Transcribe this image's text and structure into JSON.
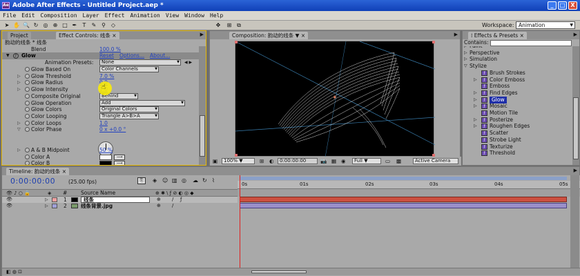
{
  "window": {
    "title": "Adobe After Effects - Untitled Project.aep *",
    "app_icon": "Ae",
    "buttons": [
      "_",
      "□",
      "X"
    ]
  },
  "menu": [
    "File",
    "Edit",
    "Composition",
    "Layer",
    "Effect",
    "Animation",
    "View",
    "Window",
    "Help"
  ],
  "toolbar": {
    "workspace_label": "Workspace:",
    "workspace_value": "Animation"
  },
  "effect_panel": {
    "tabs": [
      "Project",
      "Effect Controls: 线条"
    ],
    "header": "韵动的线条 * 线条",
    "top_row": {
      "label": "Blend",
      "value": "100.0 %"
    },
    "effect_name": "Glow",
    "effect_links": [
      "Reset",
      "Options...",
      "About..."
    ],
    "presets_label": "Animation Presets:",
    "presets_value": "None",
    "rows": [
      {
        "label": "Glow Based On",
        "type": "drop",
        "value": "Color Channels"
      },
      {
        "label": "Glow Threshold",
        "type": "val",
        "value": "7.0 %"
      },
      {
        "label": "Glow Radius",
        "type": "val",
        "value": "0.0"
      },
      {
        "label": "Glow Intensity",
        "type": "val",
        "value": "1.0"
      },
      {
        "label": "Composite Original",
        "type": "drop",
        "value": "Behind"
      },
      {
        "label": "Glow Operation",
        "type": "drop",
        "value": "Add"
      },
      {
        "label": "Glow Colors",
        "type": "drop",
        "value": "Original Colors"
      },
      {
        "label": "Color Looping",
        "type": "drop",
        "value": "Triangle A>B>A"
      },
      {
        "label": "Color Loops",
        "type": "val",
        "value": "1.0"
      },
      {
        "label": "Color Phase",
        "type": "val",
        "value": "0 x +0.0 °"
      }
    ],
    "rows_bottom": [
      {
        "label": "A & B Midpoint",
        "type": "val",
        "value": "50 %"
      },
      {
        "label": "Color A",
        "type": "swatch",
        "value": "#ffffff"
      },
      {
        "label": "Color B",
        "type": "swatch",
        "value": "#000000"
      }
    ]
  },
  "comp_panel": {
    "tab": "Composition: 韵动的线条",
    "zoom": "100%",
    "timecode": "0:00:00:00",
    "resolution": "Full",
    "camera": "Active Camera"
  },
  "presets_panel": {
    "tab": "Effects & Presets",
    "contains_label": "Contains:",
    "items": [
      {
        "label": "Paint",
        "level": 0,
        "icon": false
      },
      {
        "label": "Perspective",
        "level": 0,
        "icon": false
      },
      {
        "label": "Simulation",
        "level": 0,
        "icon": false
      },
      {
        "label": "Stylize",
        "level": 0,
        "icon": false,
        "open": true
      },
      {
        "label": "Brush Strokes",
        "level": 1,
        "icon": true
      },
      {
        "label": "Color Emboss",
        "level": 1,
        "icon": true,
        "arrow": true
      },
      {
        "label": "Emboss",
        "level": 1,
        "icon": true
      },
      {
        "label": "Find Edges",
        "level": 1,
        "icon": true,
        "arrow": true
      },
      {
        "label": "Glow",
        "level": 1,
        "icon": true,
        "arrow": true,
        "selected": true
      },
      {
        "label": "Mosaic",
        "level": 1,
        "icon": true,
        "arrow": true
      },
      {
        "label": "Motion Tile",
        "level": 1,
        "icon": true
      },
      {
        "label": "Posterize",
        "level": 1,
        "icon": true,
        "arrow": true
      },
      {
        "label": "Roughen Edges",
        "level": 1,
        "icon": true,
        "arrow": true
      },
      {
        "label": "Scatter",
        "level": 1,
        "icon": true
      },
      {
        "label": "Strobe Light",
        "level": 1,
        "icon": true
      },
      {
        "label": "Texturize",
        "level": 1,
        "icon": true
      },
      {
        "label": "Threshold",
        "level": 1,
        "icon": true
      }
    ]
  },
  "timeline": {
    "tab": "Timeline: 韵动的线条",
    "timecode": "0:00:00:00",
    "fps": "(25.00 fps)",
    "col_num": "#",
    "col_source": "Source Name",
    "ruler": [
      "0s",
      "01s",
      "02s",
      "03s",
      "04s",
      "05s"
    ],
    "layers": [
      {
        "num": "1",
        "name": "线条",
        "label_color": "#f0a0a0"
      },
      {
        "num": "2",
        "name": "线条背景.jpg",
        "label_color": "#a0a0d8"
      }
    ]
  }
}
